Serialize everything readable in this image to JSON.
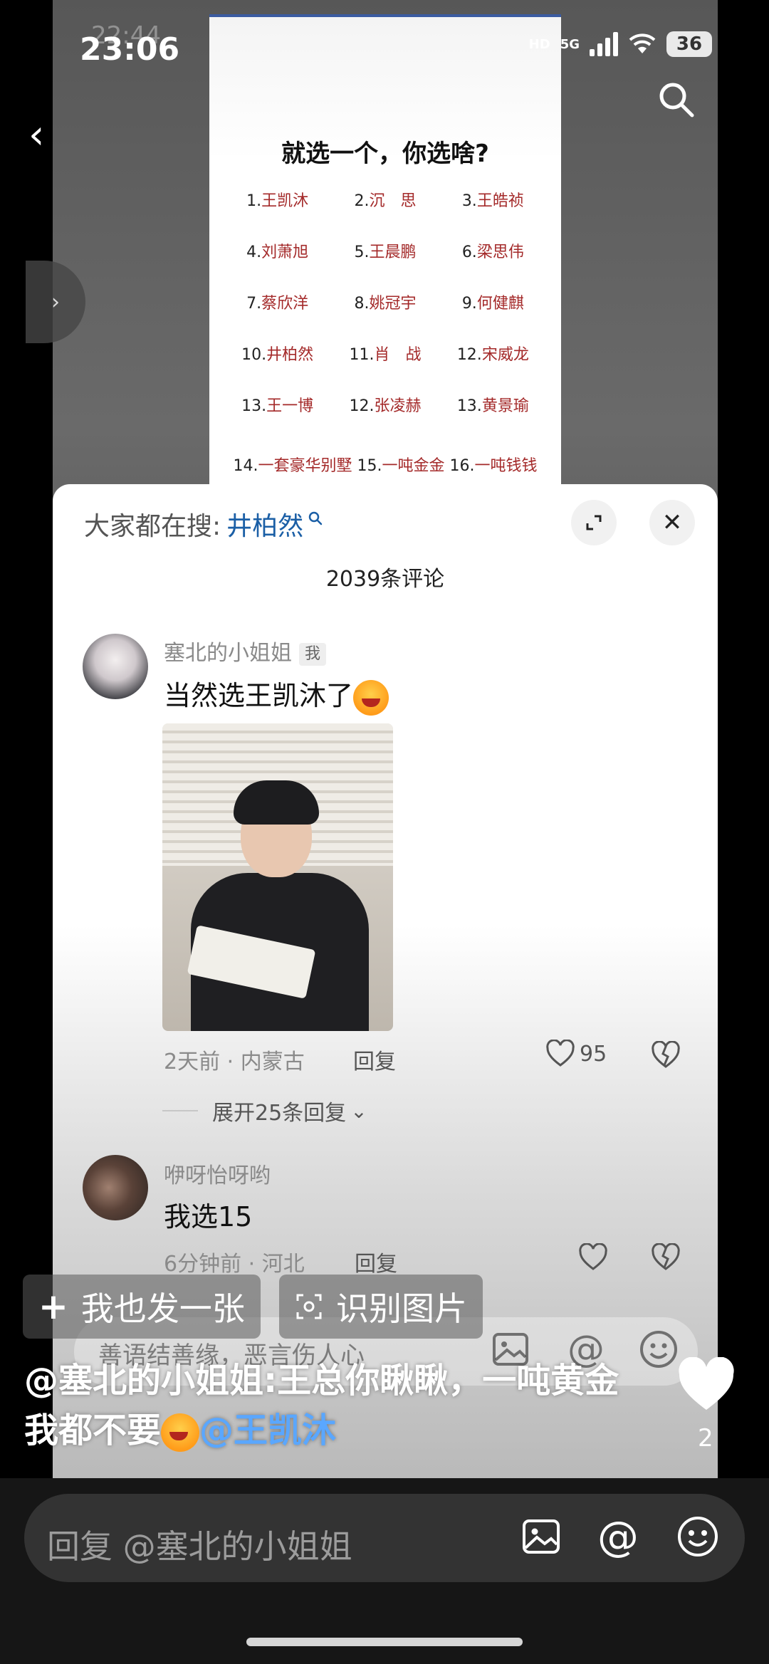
{
  "status_bar": {
    "time": "23:06",
    "ghost_time": "22:44",
    "network": "5G",
    "hd_label": "HD",
    "battery": "36"
  },
  "video": {
    "poster": {
      "title": "就选一个，你选啥?",
      "items": [
        {
          "num": "1.",
          "name": "王凯沐"
        },
        {
          "num": "2.",
          "name": "沉　思"
        },
        {
          "num": "3.",
          "name": "王皓祯"
        },
        {
          "num": "4.",
          "name": "刘萧旭"
        },
        {
          "num": "5.",
          "name": "王晨鹏"
        },
        {
          "num": "6.",
          "name": "梁思伟"
        },
        {
          "num": "7.",
          "name": "蔡欣洋"
        },
        {
          "num": "8.",
          "name": "姚冠宇"
        },
        {
          "num": "9.",
          "name": "何健麒"
        },
        {
          "num": "10.",
          "name": "井柏然"
        },
        {
          "num": "11.",
          "name": "肖　战"
        },
        {
          "num": "12.",
          "name": "宋威龙"
        },
        {
          "num": "13.",
          "name": "王一博"
        },
        {
          "num": "12.",
          "name": "张凌赫"
        },
        {
          "num": "13.",
          "name": "黄景瑜"
        }
      ],
      "last_row": [
        {
          "num": "14.",
          "name": "一套豪华别墅"
        },
        {
          "num": "15.",
          "name": "一吨金金"
        },
        {
          "num": "16.",
          "name": "一吨钱钱"
        }
      ]
    },
    "caption_user": "@塞北的小姐姐",
    "caption_text": ":王总你瞅瞅，一吨黄金我都不要",
    "caption_mention": "@王凯沐",
    "like_count": "2"
  },
  "comments_sheet": {
    "search_prefix": "大家都在搜:",
    "search_keyword": "井柏然",
    "comment_count": "2039条评论",
    "comments": [
      {
        "username": "塞北的小姐姐",
        "badge": "我",
        "text": "当然选王凯沐了",
        "time": "2天前",
        "location": "内蒙古",
        "reply_label": "回复",
        "likes": "95",
        "expand_label": "展开25条回复"
      },
      {
        "username": "咿呀怡呀哟",
        "text": "我选15",
        "time": "6分钟前",
        "location": "河北",
        "reply_label": "回复"
      }
    ],
    "input_placeholder": "善语结善缘，恶言伤人心"
  },
  "actions": {
    "post_label": "我也发一张",
    "recognize_label": "识别图片"
  },
  "reply_bar": {
    "placeholder": "回复 @塞北的小姐姐"
  },
  "colors": {
    "mention": "#5aa7ff",
    "keyword": "#1b5fa6",
    "poster_name": "#a42a2a"
  }
}
